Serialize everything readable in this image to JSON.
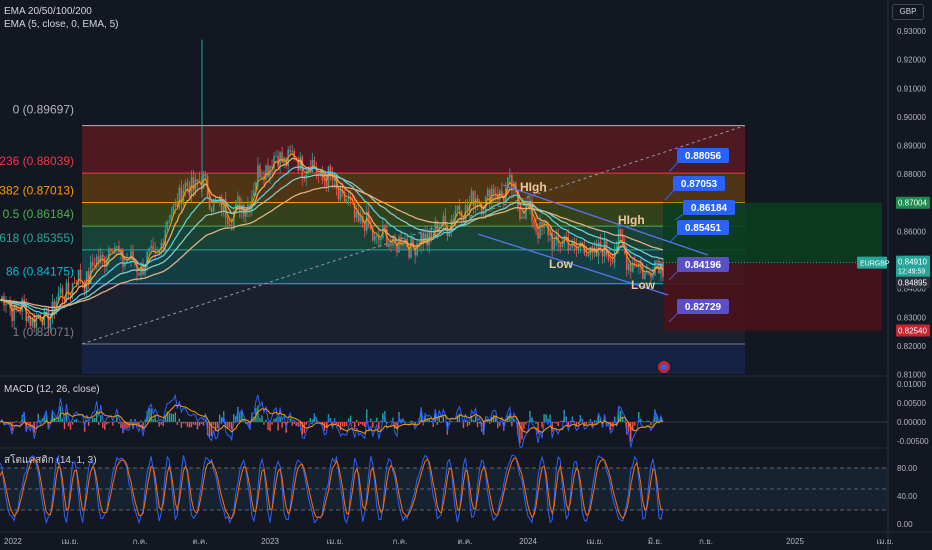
{
  "header": {
    "ema_label": "EMA 20/50/100/200",
    "ema5_label": "EMA (5, close, 0, EMA, 5)",
    "currency": "GBP",
    "symbol_tag": "EURGBP",
    "last_price": "0.84910",
    "countdown": "12:49:59",
    "below_price": "0.84895"
  },
  "price_axis": {
    "ticks": [
      "0.93000",
      "0.92000",
      "0.91000",
      "0.90000",
      "0.89000",
      "0.88000",
      "0.87000",
      "0.86000",
      "0.85000",
      "0.84000",
      "0.83000",
      "0.82000",
      "0.81000"
    ],
    "target_label": "0.87004",
    "stop_label": "0.82540"
  },
  "fib_levels": [
    {
      "label": "0 (0.89697)",
      "value": 0.89697,
      "color": "#b2b5be"
    },
    {
      "label": "236 (0.88039)",
      "value": 0.88039,
      "color": "#f23645"
    },
    {
      "label": "382 (0.87013)",
      "value": 0.87013,
      "color": "#ff9800"
    },
    {
      "label": "0.5 (0.86184)",
      "value": 0.86184,
      "color": "#4caf50"
    },
    {
      "label": "618 (0.85355)",
      "value": 0.85355,
      "color": "#26a69a"
    },
    {
      "label": "86 (0.84175)",
      "value": 0.84175,
      "color": "#00bcd4"
    },
    {
      "label": "1 (0.82071)",
      "value": 0.82071,
      "color": "#787b86"
    }
  ],
  "callouts": [
    {
      "text": "0.88056",
      "color": "#2962ff"
    },
    {
      "text": "0.87053",
      "color": "#2962ff"
    },
    {
      "text": "0.86184",
      "color": "#2962ff"
    },
    {
      "text": "0.85451",
      "color": "#2962ff"
    },
    {
      "text": "0.84196",
      "color": "#5b4fc4"
    },
    {
      "text": "0.82729",
      "color": "#5b4fc4"
    }
  ],
  "annotations": [
    {
      "text": "HIgh"
    },
    {
      "text": "HIgh"
    },
    {
      "text": "Low"
    },
    {
      "text": "Low"
    }
  ],
  "macd": {
    "label": "MACD (12, 26, close)",
    "ticks": [
      "0.01000",
      "0.00500",
      "0.00000",
      "-0.00500"
    ]
  },
  "stoch": {
    "label": "สโตแคสติก (14, 1, 3)",
    "ticks": [
      "80.00",
      "40.00",
      "0.00"
    ]
  },
  "time_axis": [
    "2022",
    "เม.ย.",
    "ก.ค.",
    "ต.ค.",
    "2023",
    "เม.ย.",
    "ก.ค.",
    "ต.ค.",
    "2024",
    "เม.ย.",
    "มิ.ย.",
    "ก.ย.",
    "2025",
    "เม.ย."
  ],
  "chart_data": {
    "type": "line",
    "symbol": "EURGBP",
    "currency": "GBP",
    "ylim": [
      0.81,
      0.935
    ],
    "x": [
      "2022-01",
      "2022-02",
      "2022-03",
      "2022-04",
      "2022-05",
      "2022-06",
      "2022-07",
      "2022-08",
      "2022-09",
      "2022-10",
      "2022-11",
      "2022-12",
      "2023-01",
      "2023-02",
      "2023-03",
      "2023-04",
      "2023-05",
      "2023-06",
      "2023-07",
      "2023-08",
      "2023-09",
      "2023-10",
      "2023-11",
      "2023-12",
      "2024-01",
      "2024-02",
      "2024-03",
      "2024-04",
      "2024-05",
      "2024-06",
      "2024-07"
    ],
    "series": [
      {
        "name": "EURGBP",
        "values": [
          0.836,
          0.832,
          0.829,
          0.84,
          0.845,
          0.855,
          0.848,
          0.85,
          0.872,
          0.878,
          0.867,
          0.868,
          0.884,
          0.886,
          0.883,
          0.877,
          0.866,
          0.858,
          0.856,
          0.856,
          0.862,
          0.869,
          0.872,
          0.875,
          0.865,
          0.857,
          0.855,
          0.852,
          0.855,
          0.846,
          0.849
        ]
      }
    ],
    "fib_levels": [
      0.89697,
      0.88039,
      0.87013,
      0.86184,
      0.85355,
      0.84175,
      0.82071
    ],
    "target": 0.87004,
    "stop": 0.8254,
    "last": 0.8491
  }
}
